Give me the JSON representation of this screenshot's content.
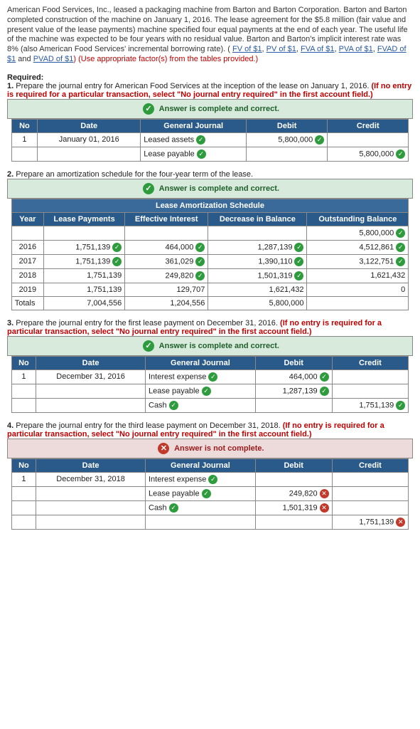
{
  "intro_text": "American Food Services, Inc., leased a packaging machine from Barton and Barton Corporation. Barton and Barton completed construction of the machine on January 1, 2016. The lease agreement for the $5.8 million (fair value and present value of the lease payments) machine specified four equal payments at the end of each year. The useful life of the machine was expected to be four years with no residual value. Barton and Barton's implicit interest rate was 8% (also American Food Services' incremental borrowing rate). (",
  "intro_links": [
    "FV of $1",
    "PV of $1",
    "FVA of $1",
    "PVA of $1",
    "FVAD of $1",
    "PVAD of $1"
  ],
  "intro_tail": ") (Use appropriate factor(s) from the tables provided.)",
  "required_label": "Required:",
  "q1": {
    "num": "1.",
    "text": "Prepare the journal entry for American Food Services at the inception of the lease on January 1, 2016.",
    "red": " (If no entry is required for a particular transaction, select \"No journal entry required\" in the first account field.)",
    "status": "Answer is complete and correct.",
    "status_ok": true,
    "headers": {
      "no": "No",
      "date": "Date",
      "gj": "General Journal",
      "debit": "Debit",
      "credit": "Credit"
    },
    "rows": [
      {
        "no": "1",
        "date": "January 01, 2016",
        "account": "Leased assets",
        "mark": "ok",
        "debit": "5,800,000",
        "debit_mark": "ok",
        "credit": ""
      },
      {
        "no": "",
        "date": "",
        "account": "Lease payable",
        "mark": "ok",
        "debit": "",
        "credit": "5,800,000",
        "credit_mark": "ok"
      }
    ]
  },
  "q2": {
    "num": "2.",
    "text": "Prepare an amortization schedule for the four-year term of the lease.",
    "status": "Answer is complete and correct.",
    "status_ok": true,
    "title": "Lease Amortization Schedule",
    "headers": {
      "year": "Year",
      "pay": "Lease Payments",
      "int": "Effective Interest",
      "dec": "Decrease in Balance",
      "bal": "Outstanding Balance"
    },
    "rows": [
      {
        "year": "",
        "pay": "",
        "int": "",
        "dec": "",
        "bal": "5,800,000",
        "bal_mark": "ok"
      },
      {
        "year": "2016",
        "pay": "1,751,139",
        "pay_mark": "ok",
        "int": "464,000",
        "int_mark": "ok",
        "dec": "1,287,139",
        "dec_mark": "ok",
        "bal": "4,512,861",
        "bal_mark": "ok"
      },
      {
        "year": "2017",
        "pay": "1,751,139",
        "pay_mark": "ok",
        "int": "361,029",
        "int_mark": "ok",
        "dec": "1,390,110",
        "dec_mark": "ok",
        "bal": "3,122,751",
        "bal_mark": "ok"
      },
      {
        "year": "2018",
        "pay": "1,751,139",
        "int": "249,820",
        "int_mark": "ok",
        "dec": "1,501,319",
        "dec_mark": "ok",
        "bal": "1,621,432"
      },
      {
        "year": "2019",
        "pay": "1,751,139",
        "int": "129,707",
        "dec": "1,621,432",
        "bal": "0"
      },
      {
        "year": "Totals",
        "pay": "7,004,556",
        "int": "1,204,556",
        "dec": "5,800,000",
        "bal": ""
      }
    ]
  },
  "q3": {
    "num": "3.",
    "text": "Prepare the journal entry for the first lease payment on December 31, 2016.",
    "red": " (If no entry is required for a particular transaction, select \"No journal entry required\" in the first account field.)",
    "status": "Answer is complete and correct.",
    "status_ok": true,
    "headers": {
      "no": "No",
      "date": "Date",
      "gj": "General Journal",
      "debit": "Debit",
      "credit": "Credit"
    },
    "rows": [
      {
        "no": "1",
        "date": "December 31, 2016",
        "account": "Interest expense",
        "mark": "ok",
        "debit": "464,000",
        "debit_mark": "ok",
        "credit": ""
      },
      {
        "no": "",
        "date": "",
        "account": "Lease payable",
        "mark": "ok",
        "debit": "1,287,139",
        "debit_mark": "ok",
        "credit": ""
      },
      {
        "no": "",
        "date": "",
        "account": "Cash",
        "mark": "ok",
        "debit": "",
        "credit": "1,751,139",
        "credit_mark": "ok"
      }
    ]
  },
  "q4": {
    "num": "4.",
    "text": "Prepare the journal entry for the third lease payment on December 31, 2018.",
    "red": " (If no entry is required for a particular transaction, select \"No journal entry required\" in the first account field.)",
    "status": "Answer is not complete.",
    "status_ok": false,
    "headers": {
      "no": "No",
      "date": "Date",
      "gj": "General Journal",
      "debit": "Debit",
      "credit": "Credit"
    },
    "rows": [
      {
        "no": "1",
        "date": "December 31, 2018",
        "account": "Interest expense",
        "mark": "ok",
        "debit": "",
        "credit": ""
      },
      {
        "no": "",
        "date": "",
        "account": "Lease payable",
        "mark": "ok",
        "debit": "249,820",
        "debit_mark": "no",
        "credit": ""
      },
      {
        "no": "",
        "date": "",
        "account": "Cash",
        "mark": "ok",
        "debit": "1,501,319",
        "debit_mark": "no",
        "credit": ""
      },
      {
        "no": "",
        "date": "",
        "account": "",
        "debit": "",
        "credit": "1,751,139",
        "credit_mark": "no"
      }
    ]
  }
}
